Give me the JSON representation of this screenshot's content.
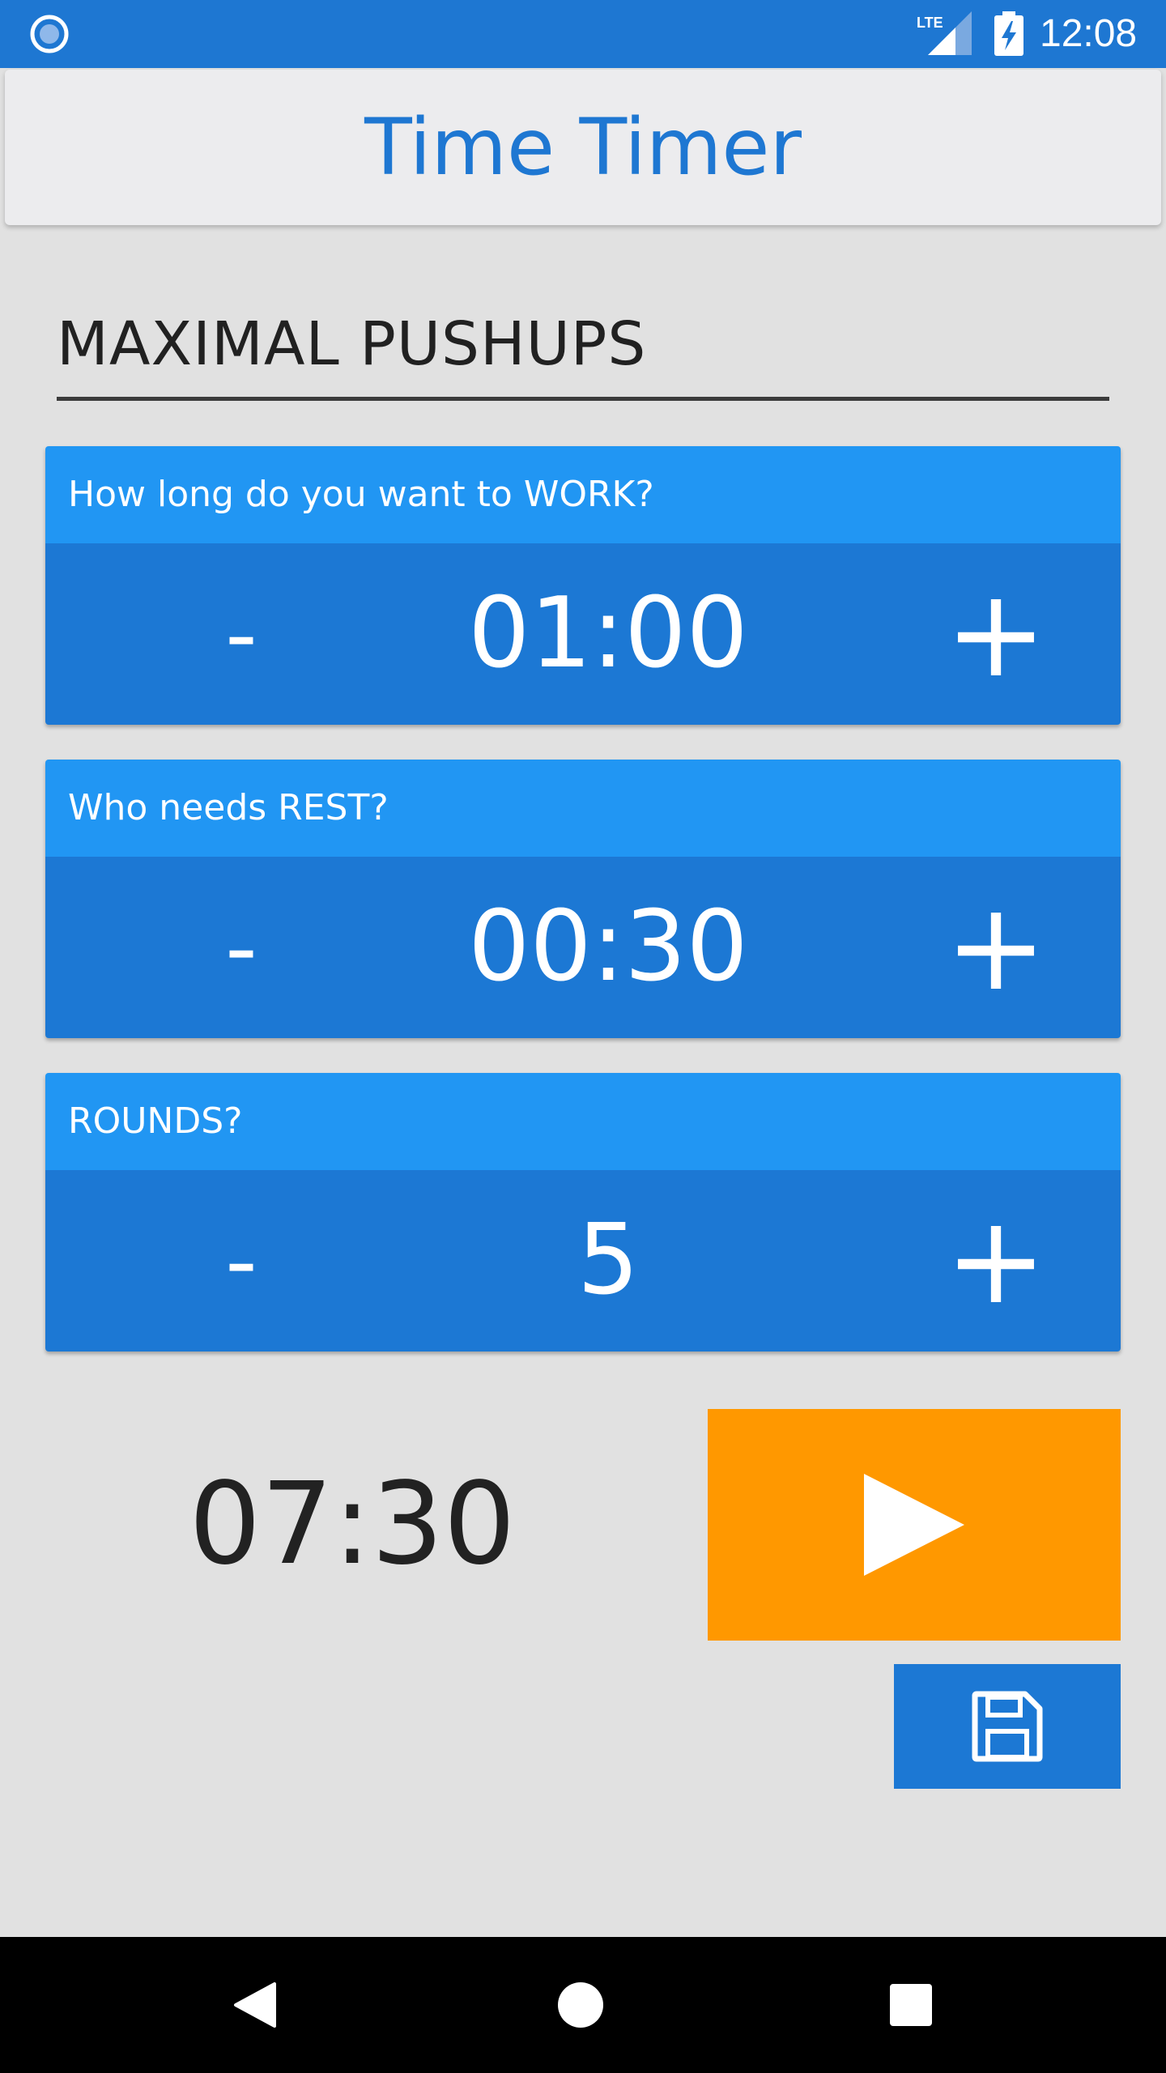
{
  "status_bar": {
    "left_icon": "notification-circle-icon",
    "network_label": "LTE",
    "battery_icon": "battery-charging-icon",
    "time": "12:08",
    "background_color": "#1e77d2"
  },
  "app_bar": {
    "title": "Time Timer",
    "title_color": "#1e77d2"
  },
  "workout": {
    "name": "MAXIMAL PUSHUPS"
  },
  "cards": [
    {
      "label": "How long do you want to WORK?",
      "value": "01:00",
      "decrement_label": "-",
      "increment_label": "+"
    },
    {
      "label": "Who needs REST?",
      "value": "00:30",
      "decrement_label": "-",
      "increment_label": "+"
    },
    {
      "label": "ROUNDS?",
      "value": "5",
      "decrement_label": "-",
      "increment_label": "+"
    }
  ],
  "summary": {
    "total_time": "07:30",
    "start_icon": "play-icon",
    "save_icon": "floppy-disk-icon"
  },
  "colors": {
    "card_header": "#2196f3",
    "card_body": "#1c78d4",
    "start_button": "#ff9800",
    "background": "#e1e1e1"
  },
  "nav_bar": {
    "back_icon": "back-triangle-icon",
    "home_icon": "home-circle-icon",
    "recents_icon": "recents-square-icon"
  }
}
